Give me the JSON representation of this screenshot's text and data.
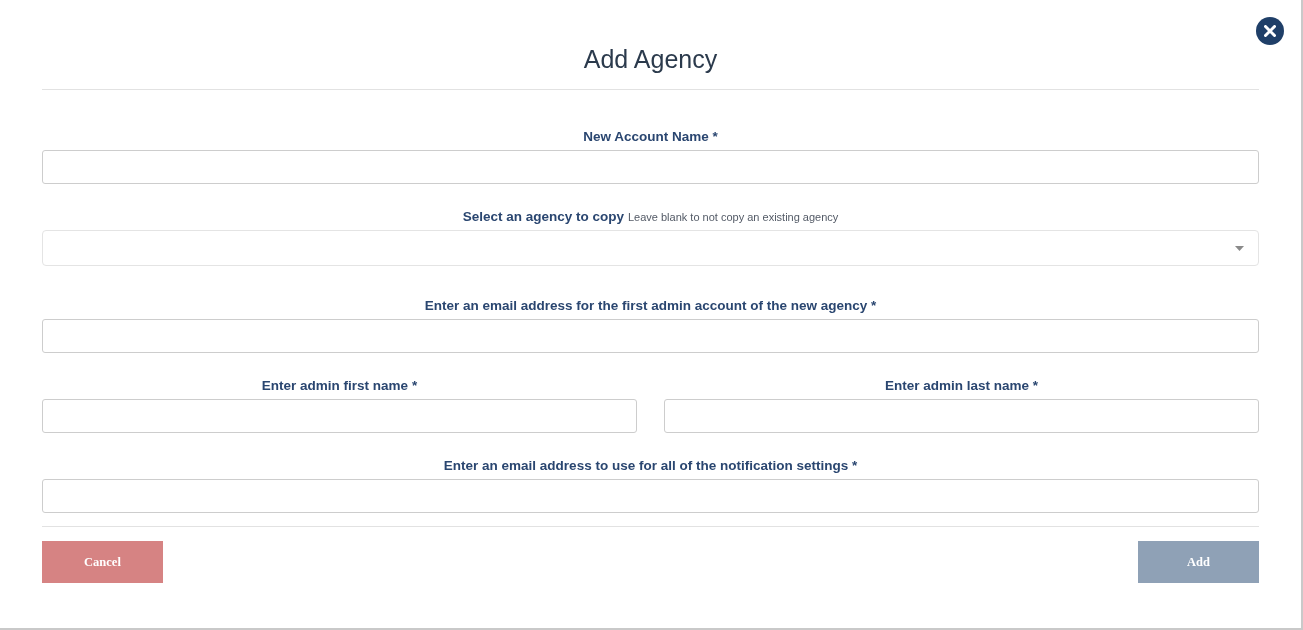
{
  "dialog": {
    "title": "Add Agency"
  },
  "rows": [
    {
      "fields": [
        {
          "kind": "text",
          "label": "New Account Name *"
        }
      ]
    },
    {
      "fields": [
        {
          "kind": "select",
          "label": "Select an agency to copy",
          "hint": "Leave blank to not copy an existing agency"
        }
      ]
    },
    {
      "fields": [
        {
          "kind": "text",
          "label": "Enter an email address for the first admin account of the new agency *"
        }
      ]
    },
    {
      "fields": [
        {
          "kind": "text",
          "label": "Enter admin first name *"
        },
        {
          "kind": "text",
          "label": "Enter admin last name *"
        }
      ]
    },
    {
      "fields": [
        {
          "kind": "text",
          "label": "Enter an email address to use for all of the notification settings *"
        }
      ]
    }
  ],
  "buttons": [
    {
      "kind": "cancel",
      "label": "Cancel"
    },
    {
      "kind": "submit",
      "label": "Add"
    }
  ]
}
